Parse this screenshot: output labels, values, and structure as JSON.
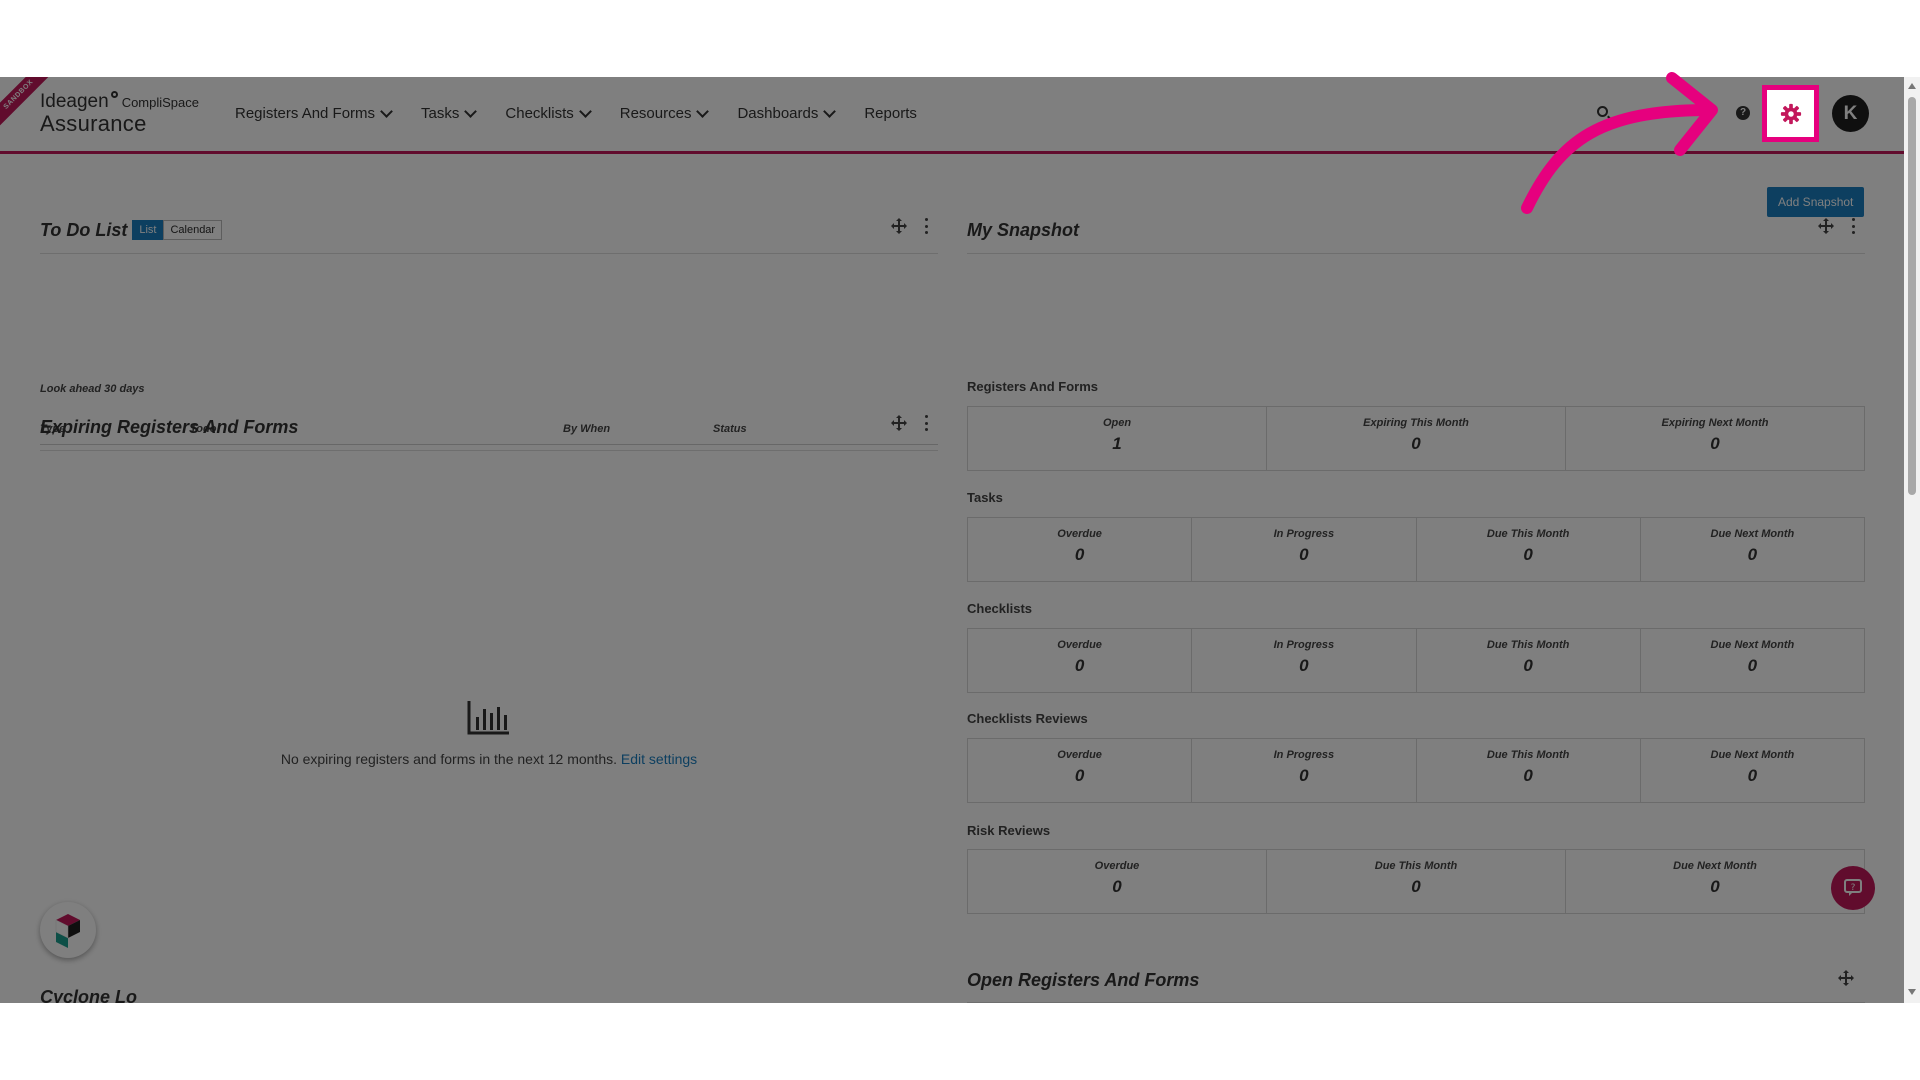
{
  "header": {
    "ribbon_text": "SANDBOX",
    "brand": "Ideagen",
    "brand_sub": "CompliSpace",
    "product": "Assurance",
    "nav": [
      {
        "label": "Registers And Forms"
      },
      {
        "label": "Tasks"
      },
      {
        "label": "Checklists"
      },
      {
        "label": "Resources"
      },
      {
        "label": "Dashboards"
      },
      {
        "label": "Reports"
      }
    ],
    "help_glyph": "?",
    "avatar_initial": "K"
  },
  "actions": {
    "add_snapshot": "Add Snapshot"
  },
  "todo": {
    "title": "To Do List",
    "toggle_list": "List",
    "toggle_calendar": "Calendar",
    "look_ahead": "Look ahead 30 days",
    "columns": [
      "Type",
      "Todo",
      "By When",
      "Status"
    ]
  },
  "expiring": {
    "title": "Expiring Registers And Forms",
    "empty_text": "No expiring registers and forms in the next 12 months.",
    "edit_link": "Edit settings"
  },
  "next_widget_title": "Cyclone Lo",
  "snapshot": {
    "title": "My Snapshot",
    "sections": [
      {
        "name": "Registers And Forms",
        "cells": [
          {
            "label": "Open",
            "value": "1"
          },
          {
            "label": "Expiring This Month",
            "value": "0"
          },
          {
            "label": "Expiring Next Month",
            "value": "0"
          }
        ]
      },
      {
        "name": "Tasks",
        "cells": [
          {
            "label": "Overdue",
            "value": "0"
          },
          {
            "label": "In Progress",
            "value": "0"
          },
          {
            "label": "Due This Month",
            "value": "0"
          },
          {
            "label": "Due Next Month",
            "value": "0"
          }
        ]
      },
      {
        "name": "Checklists",
        "cells": [
          {
            "label": "Overdue",
            "value": "0"
          },
          {
            "label": "In Progress",
            "value": "0"
          },
          {
            "label": "Due This Month",
            "value": "0"
          },
          {
            "label": "Due Next Month",
            "value": "0"
          }
        ]
      },
      {
        "name": "Checklists Reviews",
        "cells": [
          {
            "label": "Overdue",
            "value": "0"
          },
          {
            "label": "In Progress",
            "value": "0"
          },
          {
            "label": "Due This Month",
            "value": "0"
          },
          {
            "label": "Due Next Month",
            "value": "0"
          }
        ]
      },
      {
        "name": "Risk Reviews",
        "cells": [
          {
            "label": "Overdue",
            "value": "0"
          },
          {
            "label": "Due This Month",
            "value": "0"
          },
          {
            "label": "Due Next Month",
            "value": "0"
          }
        ]
      }
    ]
  },
  "open_registers": {
    "title": "Open Registers And Forms"
  },
  "colors": {
    "accent": "#c2185b",
    "highlight": "#e6007e",
    "primary": "#1a7fc1"
  }
}
